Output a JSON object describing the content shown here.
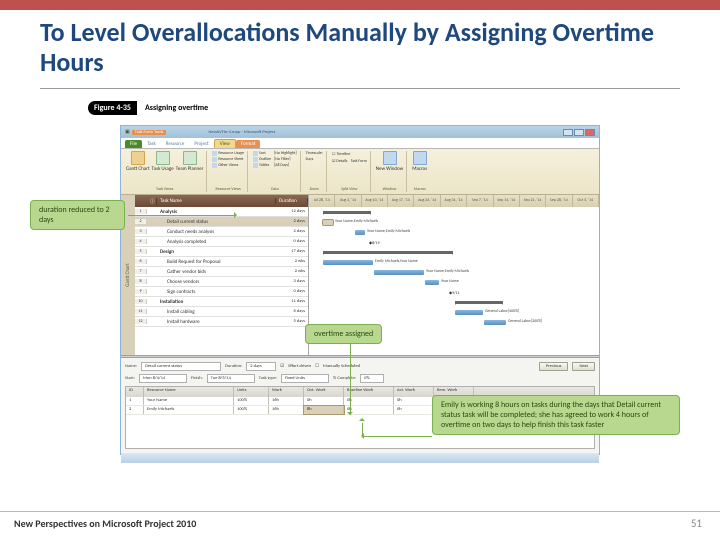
{
  "slide": {
    "title": "To Level Overallocations Manually by Assigning Overtime Hours",
    "footer_left": "New Perspectives on Microsoft Project 2010",
    "footer_right": "51"
  },
  "figure": {
    "label": "Figure 4-35",
    "caption": "Assigning overtime"
  },
  "callouts": {
    "left": "duration reduced to 2 days",
    "mid": "overtime assigned",
    "right": "Emily is working 8 hours on tasks during the days that Detail current status task will be completed; she has agreed to work 4 hours of overtime on two days to help finish this task faster"
  },
  "window": {
    "file_title": "NewAVFin-4.mpp - Microsoft Project",
    "tool_tab": "Task Form Tools"
  },
  "ribbon_tabs": [
    "File",
    "Task",
    "Resource",
    "Project",
    "View",
    "Format"
  ],
  "ribbon": {
    "g1": {
      "name": "Task Views",
      "b1": "Gantt Chart",
      "b2": "Task Usage",
      "b3": "Team Planner"
    },
    "g2": {
      "name": "Resource Views",
      "r1": "Resource Usage",
      "r2": "Resource Sheet",
      "r3": "Other Views"
    },
    "g3": {
      "name": "Data",
      "sort": "Sort",
      "outline": "Outline",
      "tables": "Tables",
      "hl": "[No Highlight]",
      "filt": "[No Filter]",
      "grp": "[All Days]"
    },
    "g4": {
      "name": "Zoom",
      "ts": "Timescale:",
      "days": "Days"
    },
    "g5": {
      "name": "Split View",
      "tl": "Timeline",
      "det": "Details",
      "tf": "Task Form"
    },
    "g6": {
      "name": "Window",
      "nw": "New Window"
    },
    "g7": {
      "name": "Macros",
      "mc": "Macros"
    }
  },
  "gantt_sidebar": "Gantt Chart",
  "table_headers": {
    "task": "Task Name",
    "dur": "Duration"
  },
  "tasks": [
    {
      "id": "1",
      "name": "Analysis",
      "dur": "12 days",
      "bold": true
    },
    {
      "id": "2",
      "name": "Detail current status",
      "dur": "2 days",
      "sub": true,
      "hl": true
    },
    {
      "id": "3",
      "name": "Conduct needs analysis",
      "dur": "2 days",
      "sub": true
    },
    {
      "id": "4",
      "name": "Analysis completed",
      "dur": "0 days",
      "sub": true
    },
    {
      "id": "5",
      "name": "Design",
      "dur": "17 days",
      "bold": true
    },
    {
      "id": "6",
      "name": "Build Request for Proposal",
      "dur": "2 wks",
      "sub": true
    },
    {
      "id": "7",
      "name": "Gather vendor bids",
      "dur": "2 wks",
      "sub": true
    },
    {
      "id": "8",
      "name": "Choose vendors",
      "dur": "3 days",
      "sub": true
    },
    {
      "id": "9",
      "name": "Sign contracts",
      "dur": "0 days",
      "sub": true
    },
    {
      "id": "10",
      "name": "Installation",
      "dur": "11 days",
      "bold": true
    },
    {
      "id": "11",
      "name": "Install cabling",
      "dur": "6 days",
      "sub": true
    },
    {
      "id": "12",
      "name": "Install hardware",
      "dur": "5 days",
      "sub": true
    }
  ],
  "timeline": [
    "Jul 28, '14",
    "Aug 3, '14",
    "Aug 10, '14",
    "Aug 17, '14",
    "Aug 24, '14",
    "Aug 31, '14",
    "Sep 7, '14",
    "Sep 14, '14",
    "Sep 21, '14",
    "Sep 28, '14",
    "Oct 5, '14"
  ],
  "bar_labels": {
    "t2": "Your Name,Emily Michaels",
    "t3": "Your Name,Emily Michaels",
    "t4": "8/19",
    "t6": "Emily Michaels,Your Name",
    "t7": "Your Name,Emily Michaels",
    "t8": "Your Name",
    "t9": "9/11",
    "t11": "General Labor[400%]",
    "t12": "General Labor[200%]"
  },
  "form": {
    "name_lbl": "Name:",
    "name_val": "Detail current status",
    "dur_lbl": "Duration:",
    "dur_val": "2 days",
    "eff": "Effort driven",
    "man": "Manually Scheduled",
    "prev": "Previous",
    "next": "Next",
    "start_lbl": "Start:",
    "start_val": "Mon 8/4/14",
    "fin_lbl": "Finish:",
    "fin_val": "Tue 8/5/14",
    "tt_lbl": "Task type:",
    "tt_val": "Fixed Units",
    "pc_lbl": "% Complete:",
    "pc_val": "0%"
  },
  "grid_headers": [
    "ID",
    "Resource Name",
    "Units",
    "Work",
    "Ovt. Work",
    "Baseline Work",
    "Act. Work",
    "Rem. Work"
  ],
  "grid_rows": [
    {
      "id": "1",
      "name": "Your Name",
      "units": "100%",
      "work": "16h",
      "ovt": "0h",
      "base": "0h",
      "act": "0h",
      "rem": "16h"
    },
    {
      "id": "2",
      "name": "Emily Michaels",
      "units": "100%",
      "work": "16h",
      "ovt": "8h",
      "base": "0h",
      "act": "0h",
      "rem": "16h"
    }
  ]
}
